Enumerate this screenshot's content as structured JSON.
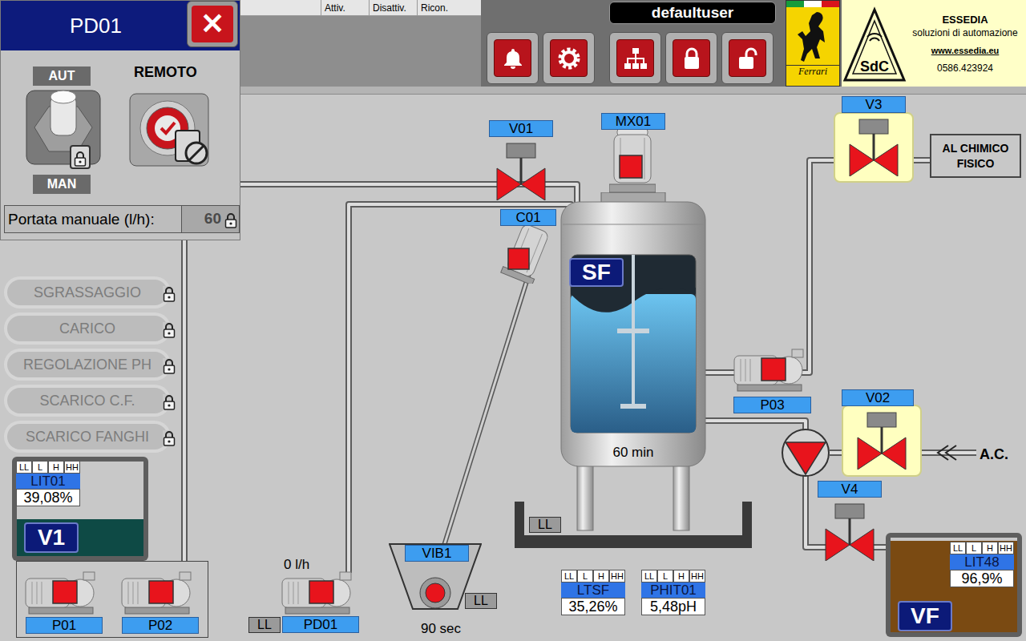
{
  "popup": {
    "title": "PD01",
    "close": "✕",
    "modes": [
      {
        "label": "AUT",
        "selected": true
      },
      {
        "label": "MAN",
        "selected": false
      }
    ],
    "mode_locked": true,
    "remote": {
      "label": "REMOTO",
      "on": true,
      "blocked": true
    },
    "flow": {
      "label": "Portata manuale (l/h):",
      "value": "60",
      "locked": true
    }
  },
  "alarm_table": {
    "columns": [
      "Attiv.",
      "Disattiv.",
      "Ricon."
    ]
  },
  "user": "defaultuser",
  "logos": {
    "ferrari": "Ferrari",
    "mark": "SdC",
    "company": "ESSEDIA",
    "tagline": "soluzioni di automazione",
    "website": "www.essedia.eu",
    "phone": "0586.423924"
  },
  "sequences": [
    {
      "label": "SGRASSAGGIO",
      "disabled": true,
      "locked": true
    },
    {
      "label": "CARICO",
      "disabled": true,
      "locked": true
    },
    {
      "label": "REGOLAZIONE PH",
      "disabled": true,
      "locked": true
    },
    {
      "label": "SCARICO C.F.",
      "disabled": true,
      "locked": true
    },
    {
      "label": "SCARICO FANGHI",
      "disabled": true,
      "locked": true
    }
  ],
  "valves": [
    {
      "tag": "V01",
      "open": false,
      "highlighted": false
    },
    {
      "tag": "V3",
      "open": false,
      "highlighted": true
    },
    {
      "tag": "V02",
      "open": false,
      "highlighted": true
    },
    {
      "tag": "V4",
      "open": false,
      "highlighted": false
    }
  ],
  "motors": [
    {
      "tag": "MX01",
      "kind": "mixer",
      "running": false
    },
    {
      "tag": "C01",
      "kind": "conveyor",
      "running": false
    },
    {
      "tag": "P03",
      "kind": "pump",
      "running": false
    },
    {
      "tag": "PD01",
      "kind": "pump",
      "running": false,
      "reading": "0 l/h"
    },
    {
      "tag": "P01",
      "kind": "pump",
      "running": false
    },
    {
      "tag": "P02",
      "kind": "pump",
      "running": false
    }
  ],
  "tanks": [
    {
      "tag": "SF",
      "kind": "reactor",
      "level": 0.78,
      "timer": "60 min"
    },
    {
      "tag": "V1",
      "kind": "vessel",
      "level": 0.39,
      "color": "#0e4a45"
    },
    {
      "tag": "VF",
      "kind": "vessel",
      "level": 0.97,
      "color": "#7a4a12"
    }
  ],
  "indicators": [
    {
      "tag": "LIT01",
      "value": "39,08%",
      "thresholds": [
        "LL",
        "L",
        "H",
        "HH"
      ]
    },
    {
      "tag": "LTSF",
      "value": "35,26%",
      "thresholds": [
        "LL",
        "L",
        "H",
        "HH"
      ]
    },
    {
      "tag": "PHIT01",
      "value": "5,48pH",
      "thresholds": [
        "LL",
        "L",
        "H",
        "HH"
      ]
    },
    {
      "tag": "LIT48",
      "value": "96,9%",
      "thresholds": [
        "LL",
        "L",
        "H",
        "HH"
      ]
    }
  ],
  "level_switches": [
    {
      "label": "LL",
      "active": false
    },
    {
      "label": "LL",
      "active": false
    },
    {
      "label": "LL",
      "active": false
    }
  ],
  "vibrator": {
    "tag": "VIB1",
    "timer": "90 sec",
    "running": false
  },
  "destinations": {
    "chemical": "AL CHIMICO FISICO",
    "ac": "A.C."
  }
}
